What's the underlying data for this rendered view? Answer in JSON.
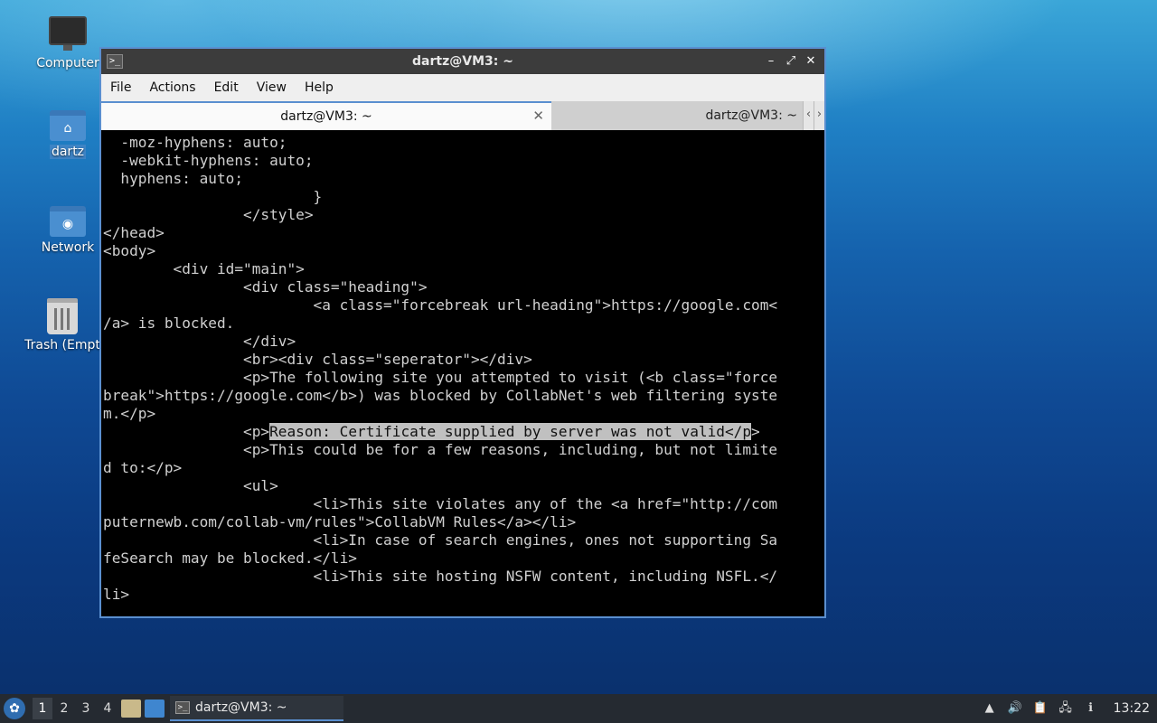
{
  "desktop": {
    "icons": [
      {
        "label": "Computer"
      },
      {
        "label": "dartz"
      },
      {
        "label": "Network"
      },
      {
        "label": "Trash (Empt"
      }
    ]
  },
  "window": {
    "title": "dartz@VM3: ~",
    "app_icon": ">_",
    "controls": {
      "minimize": "–",
      "maximize": "⤢",
      "close": "✕"
    },
    "menu": [
      "File",
      "Actions",
      "Edit",
      "View",
      "Help"
    ],
    "tabs": [
      {
        "label": "dartz@VM3: ~",
        "active": true,
        "close": "✕"
      },
      {
        "label": "dartz@VM3: ~",
        "active": false
      }
    ],
    "tab_scroll": {
      "left": "‹",
      "right": "›"
    }
  },
  "terminal": {
    "lines": [
      "  -moz-hyphens: auto;",
      "  -webkit-hyphens: auto;",
      "  hyphens: auto;",
      "                        }",
      "                </style>",
      "</head>",
      "<body>",
      "        <div id=\"main\">",
      "                <div class=\"heading\">",
      "                        <a class=\"forcebreak url-heading\">https://google.com<",
      "/a> is blocked.",
      "                </div>",
      "                <br><div class=\"seperator\"></div>",
      "                <p>The following site you attempted to visit (<b class=\"force",
      "break\">https://google.com</b>) was blocked by CollabNet's web filtering syste",
      "m.</p>"
    ],
    "hl_prefix": "                <p>",
    "hl_text": "Reason: Certificate supplied by server was not valid</p",
    "hl_suffix": ">",
    "lines_after": [
      "                <p>This could be for a few reasons, including, but not limite",
      "d to:</p>",
      "                <ul>",
      "                        <li>This site violates any of the <a href=\"http://com",
      "puternewb.com/collab-vm/rules\">CollabVM Rules</a></li>",
      "                        <li>In case of search engines, ones not supporting Sa",
      "feSearch may be blocked.</li>",
      "                        <li>This site hosting NSFW content, including NSFL.</",
      "li>"
    ]
  },
  "taskbar": {
    "start_icon": "✿",
    "workspaces": [
      "1",
      "2",
      "3",
      "4"
    ],
    "active_workspace": "1",
    "task_label": "dartz@VM3: ~",
    "task_icon": ">_",
    "tray_icons": [
      "▲",
      "🔊",
      "📋",
      "🖧",
      "ℹ"
    ],
    "clock": "13:22"
  }
}
